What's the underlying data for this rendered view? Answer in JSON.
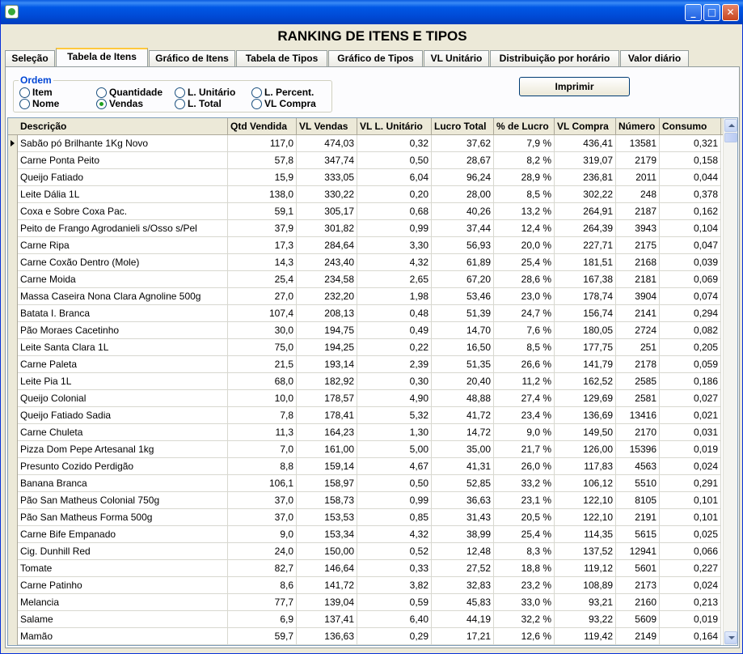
{
  "window": {
    "title": ""
  },
  "heading": "RANKING DE ITENS E TIPOS",
  "tabs": [
    "Seleção",
    "Tabela de Itens",
    "Gráfico de Itens",
    "Tabela de Tipos",
    "Gráfico de Tipos",
    "VL Unitário",
    "Distribuição por horário",
    "Valor diário"
  ],
  "active_tab": "Tabela de Itens",
  "ordem": {
    "label": "Ordem",
    "options": [
      "Item",
      "Nome",
      "Quantidade",
      "Vendas",
      "L. Unitário",
      "L. Total",
      "L. Percent.",
      "VL Compra"
    ],
    "selected": "Vendas"
  },
  "print_button": "Imprimir",
  "grid": {
    "columns": [
      "Descrição",
      "Qtd Vendida",
      "VL Vendas",
      "VL L. Unitário",
      "Lucro Total",
      "% de Lucro",
      "VL Compra",
      "Número",
      "Consumo"
    ],
    "rows": [
      [
        "Sabão pó Brilhante 1Kg Novo",
        "117,0",
        "474,03",
        "0,32",
        "37,62",
        "7,9 %",
        "436,41",
        "13581",
        "0,321"
      ],
      [
        "Carne Ponta Peito",
        "57,8",
        "347,74",
        "0,50",
        "28,67",
        "8,2 %",
        "319,07",
        "2179",
        "0,158"
      ],
      [
        "Queijo Fatiado",
        "15,9",
        "333,05",
        "6,04",
        "96,24",
        "28,9 %",
        "236,81",
        "2011",
        "0,044"
      ],
      [
        "Leite Dália 1L",
        "138,0",
        "330,22",
        "0,20",
        "28,00",
        "8,5 %",
        "302,22",
        "248",
        "0,378"
      ],
      [
        "Coxa e Sobre Coxa Pac.",
        "59,1",
        "305,17",
        "0,68",
        "40,26",
        "13,2 %",
        "264,91",
        "2187",
        "0,162"
      ],
      [
        "Peito de Frango Agrodanieli s/Osso s/Pel",
        "37,9",
        "301,82",
        "0,99",
        "37,44",
        "12,4 %",
        "264,39",
        "3943",
        "0,104"
      ],
      [
        "Carne Ripa",
        "17,3",
        "284,64",
        "3,30",
        "56,93",
        "20,0 %",
        "227,71",
        "2175",
        "0,047"
      ],
      [
        "Carne Coxão Dentro (Mole)",
        "14,3",
        "243,40",
        "4,32",
        "61,89",
        "25,4 %",
        "181,51",
        "2168",
        "0,039"
      ],
      [
        "Carne Moida",
        "25,4",
        "234,58",
        "2,65",
        "67,20",
        "28,6 %",
        "167,38",
        "2181",
        "0,069"
      ],
      [
        "Massa Caseira Nona Clara Agnoline 500g",
        "27,0",
        "232,20",
        "1,98",
        "53,46",
        "23,0 %",
        "178,74",
        "3904",
        "0,074"
      ],
      [
        "Batata I. Branca",
        "107,4",
        "208,13",
        "0,48",
        "51,39",
        "24,7 %",
        "156,74",
        "2141",
        "0,294"
      ],
      [
        "Pão Moraes Cacetinho",
        "30,0",
        "194,75",
        "0,49",
        "14,70",
        "7,6 %",
        "180,05",
        "2724",
        "0,082"
      ],
      [
        "Leite Santa Clara 1L",
        "75,0",
        "194,25",
        "0,22",
        "16,50",
        "8,5 %",
        "177,75",
        "251",
        "0,205"
      ],
      [
        "Carne Paleta",
        "21,5",
        "193,14",
        "2,39",
        "51,35",
        "26,6 %",
        "141,79",
        "2178",
        "0,059"
      ],
      [
        "Leite Pia 1L",
        "68,0",
        "182,92",
        "0,30",
        "20,40",
        "11,2 %",
        "162,52",
        "2585",
        "0,186"
      ],
      [
        "Queijo Colonial",
        "10,0",
        "178,57",
        "4,90",
        "48,88",
        "27,4 %",
        "129,69",
        "2581",
        "0,027"
      ],
      [
        "Queijo Fatiado Sadia",
        "7,8",
        "178,41",
        "5,32",
        "41,72",
        "23,4 %",
        "136,69",
        "13416",
        "0,021"
      ],
      [
        "Carne Chuleta",
        "11,3",
        "164,23",
        "1,30",
        "14,72",
        "9,0 %",
        "149,50",
        "2170",
        "0,031"
      ],
      [
        "Pizza Dom Pepe Artesanal 1kg",
        "7,0",
        "161,00",
        "5,00",
        "35,00",
        "21,7 %",
        "126,00",
        "15396",
        "0,019"
      ],
      [
        "Presunto Cozido Perdigão",
        "8,8",
        "159,14",
        "4,67",
        "41,31",
        "26,0 %",
        "117,83",
        "4563",
        "0,024"
      ],
      [
        "Banana Branca",
        "106,1",
        "158,97",
        "0,50",
        "52,85",
        "33,2 %",
        "106,12",
        "5510",
        "0,291"
      ],
      [
        "Pão San Matheus Colonial 750g",
        "37,0",
        "158,73",
        "0,99",
        "36,63",
        "23,1 %",
        "122,10",
        "8105",
        "0,101"
      ],
      [
        "Pão San Matheus Forma 500g",
        "37,0",
        "153,53",
        "0,85",
        "31,43",
        "20,5 %",
        "122,10",
        "2191",
        "0,101"
      ],
      [
        "Carne Bife Empanado",
        "9,0",
        "153,34",
        "4,32",
        "38,99",
        "25,4 %",
        "114,35",
        "5615",
        "0,025"
      ],
      [
        "Cig. Dunhill Red",
        "24,0",
        "150,00",
        "0,52",
        "12,48",
        "8,3 %",
        "137,52",
        "12941",
        "0,066"
      ],
      [
        "Tomate",
        "82,7",
        "146,64",
        "0,33",
        "27,52",
        "18,8 %",
        "119,12",
        "5601",
        "0,227"
      ],
      [
        "Carne Patinho",
        "8,6",
        "141,72",
        "3,82",
        "32,83",
        "23,2 %",
        "108,89",
        "2173",
        "0,024"
      ],
      [
        "Melancia",
        "77,7",
        "139,04",
        "0,59",
        "45,83",
        "33,0 %",
        "93,21",
        "2160",
        "0,213"
      ],
      [
        "Salame",
        "6,9",
        "137,41",
        "6,40",
        "44,19",
        "32,2 %",
        "93,22",
        "5609",
        "0,019"
      ],
      [
        "Mamão",
        "59,7",
        "136,63",
        "0,29",
        "17,21",
        "12,6 %",
        "119,42",
        "2149",
        "0,164"
      ]
    ]
  }
}
